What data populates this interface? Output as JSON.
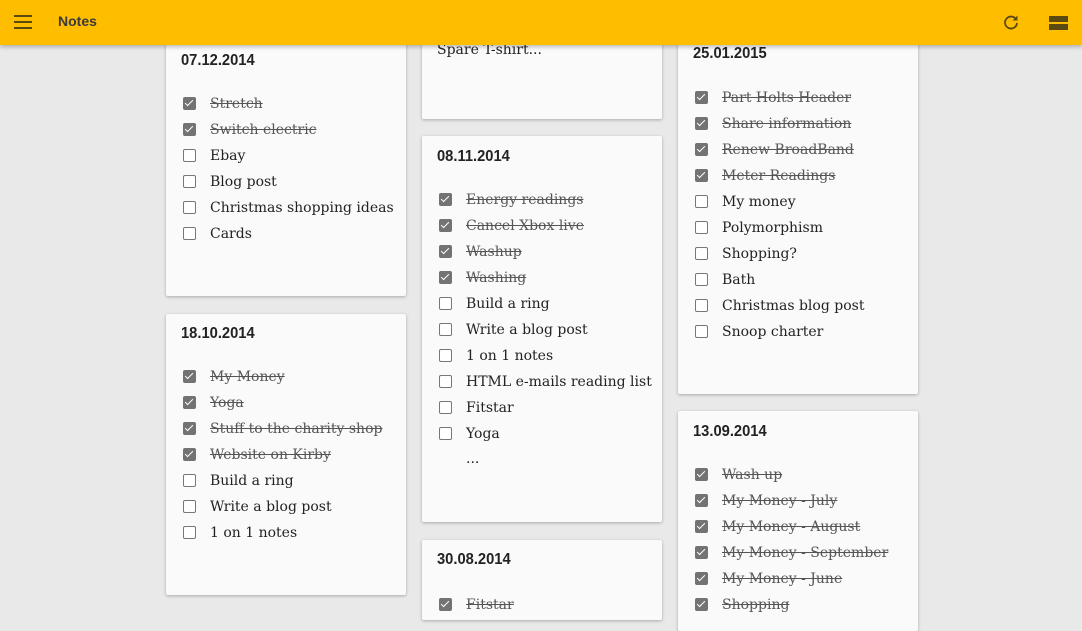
{
  "appbar": {
    "title": "Notes",
    "color": "#ffbd00",
    "menu_icon": "hamburger-menu-icon",
    "refresh_icon": "refresh-icon",
    "view_icon": "view-toggle-icon"
  },
  "cards": {
    "c1": {
      "title": "07.12.2014",
      "items": [
        {
          "label": "Stretch",
          "done": true
        },
        {
          "label": "Switch electric",
          "done": true
        },
        {
          "label": "Ebay",
          "done": false
        },
        {
          "label": "Blog post",
          "done": false
        },
        {
          "label": "Christmas shopping ideas",
          "done": false
        },
        {
          "label": "Cards",
          "done": false
        }
      ]
    },
    "c2": {
      "title": "18.10.2014",
      "items": [
        {
          "label": "My Money",
          "done": true
        },
        {
          "label": "Yoga",
          "done": true
        },
        {
          "label": "Stuff to the charity shop",
          "done": true
        },
        {
          "label": "Website on Kirby",
          "done": true
        },
        {
          "label": "Build  a ring",
          "done": false
        },
        {
          "label": "Write a blog post",
          "done": false
        },
        {
          "label": "1 on 1 notes",
          "done": false
        }
      ]
    },
    "c3": {
      "snippet": "Spare T-shirt..."
    },
    "c4": {
      "title": "08.11.2014",
      "items": [
        {
          "label": "Energy readings",
          "done": true
        },
        {
          "label": "Cancel Xbox live",
          "done": true
        },
        {
          "label": "Washup",
          "done": true
        },
        {
          "label": "Washing",
          "done": true
        },
        {
          "label": "Build a ring",
          "done": false
        },
        {
          "label": "Write a blog post",
          "done": false
        },
        {
          "label": "1 on 1 notes",
          "done": false
        },
        {
          "label": "HTML e-mails reading list",
          "done": false
        },
        {
          "label": "Fitstar",
          "done": false
        },
        {
          "label": "Yoga",
          "done": false
        }
      ],
      "ellipsis": "..."
    },
    "c5": {
      "title": "30.08.2014",
      "items": [
        {
          "label": "Fitstar",
          "done": true
        }
      ]
    },
    "c6": {
      "title": "25.01.2015",
      "items": [
        {
          "label": "Part Holts Header",
          "done": true
        },
        {
          "label": "Share information",
          "done": true
        },
        {
          "label": "Renew BroadBand",
          "done": true
        },
        {
          "label": "Meter Readings",
          "done": true
        },
        {
          "label": "My money",
          "done": false
        },
        {
          "label": "Polymorphism",
          "done": false
        },
        {
          "label": "Shopping?",
          "done": false
        },
        {
          "label": "Bath",
          "done": false
        },
        {
          "label": "Christmas blog post",
          "done": false
        },
        {
          "label": "Snoop charter",
          "done": false
        }
      ]
    },
    "c7": {
      "title": "13.09.2014",
      "items": [
        {
          "label": "Wash up",
          "done": true
        },
        {
          "label": "My Money - July",
          "done": true
        },
        {
          "label": "My Money - August",
          "done": true
        },
        {
          "label": "My Money - September",
          "done": true
        },
        {
          "label": "My Money - June",
          "done": true
        },
        {
          "label": "Shopping",
          "done": true
        }
      ]
    }
  }
}
